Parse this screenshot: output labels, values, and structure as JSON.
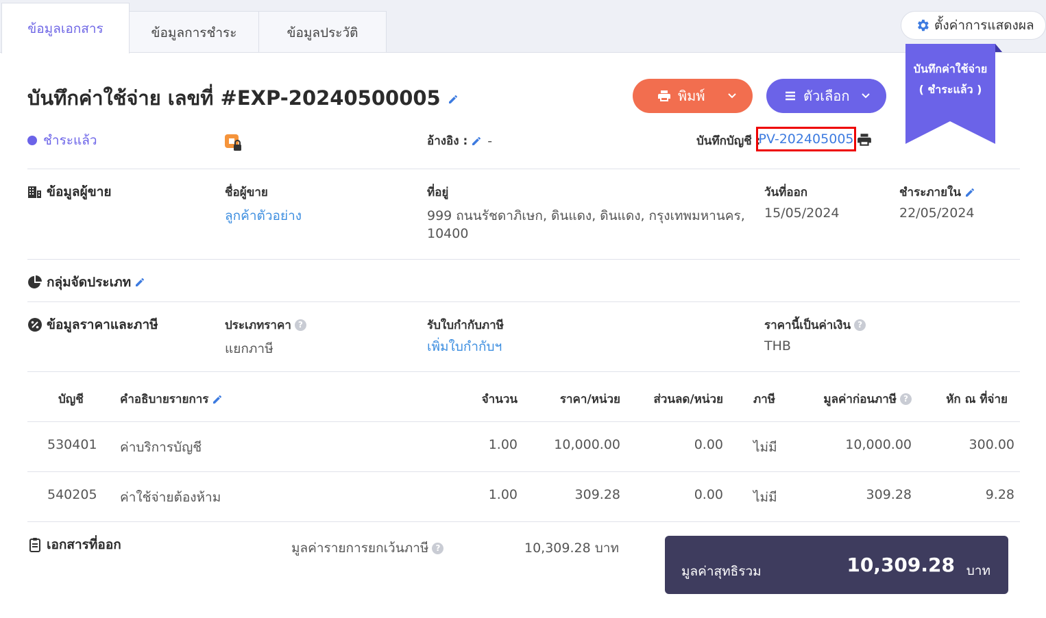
{
  "tabs": [
    {
      "label": "ข้อมูลเอกสาร",
      "active": true
    },
    {
      "label": "ข้อมูลการชำระ",
      "active": false
    },
    {
      "label": "ข้อมูลประวัติ",
      "active": false
    }
  ],
  "settings_label": "ตั้งค่าการแสดงผล",
  "ribbon": {
    "line1": "บันทึกค่าใช้จ่าย",
    "line2": "( ชำระแล้ว )"
  },
  "title": "บันทึกค่าใช้จ่าย เลขที่ #EXP-20240500005",
  "print_label": "พิมพ์",
  "options_label": "ตัวเลือก",
  "status": "ชำระแล้ว",
  "reference": {
    "label": "อ้างอิง :",
    "value": "-"
  },
  "account_entry": {
    "label": "บันทึกบัญชี :",
    "value": "PV-202405005"
  },
  "vendor": {
    "section": "ข้อมูลผู้ขาย",
    "name_label": "ชื่อผู้ขาย",
    "name": "ลูกค้าตัวอย่าง",
    "address_label": "ที่อยู่",
    "address_line1": "999 ถนนรัชดาภิเษก, ดินแดง, ดินแดง, กรุงเทพมหานคร,",
    "address_line2": "10400",
    "issue_label": "วันที่ออก",
    "issue_date": "15/05/2024",
    "due_label": "ชำระภายใน",
    "due_date": "22/05/2024"
  },
  "category_section": "กลุ่มจัดประเภท",
  "pricing": {
    "section": "ข้อมูลราคาและภาษี",
    "price_type_label": "ประเภทราคา",
    "price_type": "แยกภาษี",
    "tax_invoice_label": "รับใบกำกับภาษี",
    "tax_invoice_action": "เพิ่มใบกำกับฯ",
    "currency_label": "ราคานี้เป็นค่าเงิน",
    "currency": "THB"
  },
  "table": {
    "headers": {
      "account": "บัญชี",
      "description": "คำอธิบายรายการ",
      "qty": "จำนวน",
      "price": "ราคา/หน่วย",
      "discount": "ส่วนลด/หน่วย",
      "tax": "ภาษี",
      "pretax": "มูลค่าก่อนภาษี",
      "wht": "หัก ณ ที่จ่าย"
    },
    "rows": [
      {
        "account": "530401",
        "description": "ค่าบริการบัญชี",
        "qty": "1.00",
        "price": "10,000.00",
        "discount": "0.00",
        "tax": "ไม่มี",
        "pretax": "10,000.00",
        "wht": "300.00"
      },
      {
        "account": "540205",
        "description": "ค่าใช้จ่ายต้องห้าม",
        "qty": "1.00",
        "price": "309.28",
        "discount": "0.00",
        "tax": "ไม่มี",
        "pretax": "309.28",
        "wht": "9.28"
      }
    ]
  },
  "issued_docs": "เอกสารที่ออก",
  "exempt": {
    "label": "มูลค่ารายการยกเว้นภาษี",
    "value": "10,309.28 บาท"
  },
  "total": {
    "label": "มูลค่าสุทธิรวม",
    "value": "10,309.28",
    "unit": "บาท"
  },
  "colors": {
    "accent": "#6b63e8",
    "print": "#f26e4f",
    "link": "#3d8ee0",
    "total_bg": "#3e3c5e"
  }
}
